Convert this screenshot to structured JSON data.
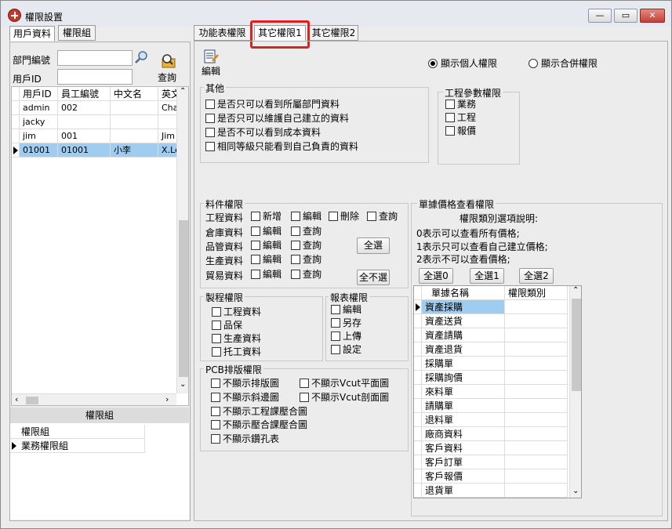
{
  "window": {
    "title": "權限設置"
  },
  "left": {
    "tabs": [
      "用戶資料",
      "權限組"
    ],
    "dept_label": "部門編號",
    "user_label": "用戶ID",
    "dept_value": "",
    "user_value": "",
    "query_label": "查詢",
    "user_grid": {
      "columns": [
        "用戶ID",
        "員工編號",
        "中文名",
        "英文"
      ],
      "rows": [
        [
          "admin",
          "002",
          "",
          "Cha"
        ],
        [
          "jacky",
          "",
          "",
          ""
        ],
        [
          "jim",
          "001",
          "",
          "Jim"
        ],
        [
          "01001",
          "01001",
          "小李",
          "X.Le"
        ]
      ]
    },
    "perm_group_header": "權限組",
    "perm_groups": [
      "權限組",
      "業務權限組"
    ]
  },
  "right": {
    "tabs": [
      "功能表權限",
      "其它權限1",
      "其它權限2"
    ],
    "edit_label": "編輯",
    "radio_personal": "顯示個人權限",
    "radio_merged": "顯示合併權限",
    "other": {
      "title": "其他",
      "items": [
        "是否只可以看到所屬部門資料",
        "是否只可以維護自己建立的資料",
        "是否不可以看到成本資料",
        "相同等級只能看到自己負責的資料"
      ]
    },
    "eng": {
      "title": "工程參數權限",
      "items": [
        "業務",
        "工程",
        "報價"
      ]
    },
    "material": {
      "title": "料件權限",
      "rows": [
        "工程資料",
        "倉庫資料",
        "品管資料",
        "生產資料",
        "貿易資料"
      ],
      "add": "新增",
      "edit": "編輯",
      "delete": "刪除",
      "query": "查詢",
      "select_all": "全選",
      "deselect_all": "全不選"
    },
    "process": {
      "title": "製程權限",
      "items": [
        "工程資料",
        "品保",
        "生產資料",
        "托工資料"
      ]
    },
    "report": {
      "title": "報表權限",
      "items": [
        "編輯",
        "另存",
        "上傳",
        "設定"
      ]
    },
    "pcb": {
      "title": "PCB排版權限",
      "items": [
        "不顯示排版圖",
        "不顯示Vcut平面圖",
        "不顯示斜邊圖",
        "不顯示Vcut剖面圖",
        "不顯示工程課壓合圖",
        "不顯示壓合課壓合圖",
        "不顯示鑽孔表"
      ]
    },
    "doc_price": {
      "title": "單據價格查看權限",
      "desc_title": "權限類別選項說明:",
      "desc": [
        "0表示可以查看所有價格;",
        "1表示只可以查看自己建立價格;",
        "2表示不可以查看價格;"
      ],
      "buttons": [
        "全選0",
        "全選1",
        "全選2"
      ],
      "columns": [
        "單據名稱",
        "權限類別"
      ],
      "rows": [
        "資產採購",
        "資產送貨",
        "資產請購",
        "資產退貨",
        "採購單",
        "採購詢價",
        "來料單",
        "請購單",
        "退料單",
        "廠商資料",
        "客戶資料",
        "客戶訂單",
        "客戶報價",
        "退貨單"
      ]
    }
  }
}
